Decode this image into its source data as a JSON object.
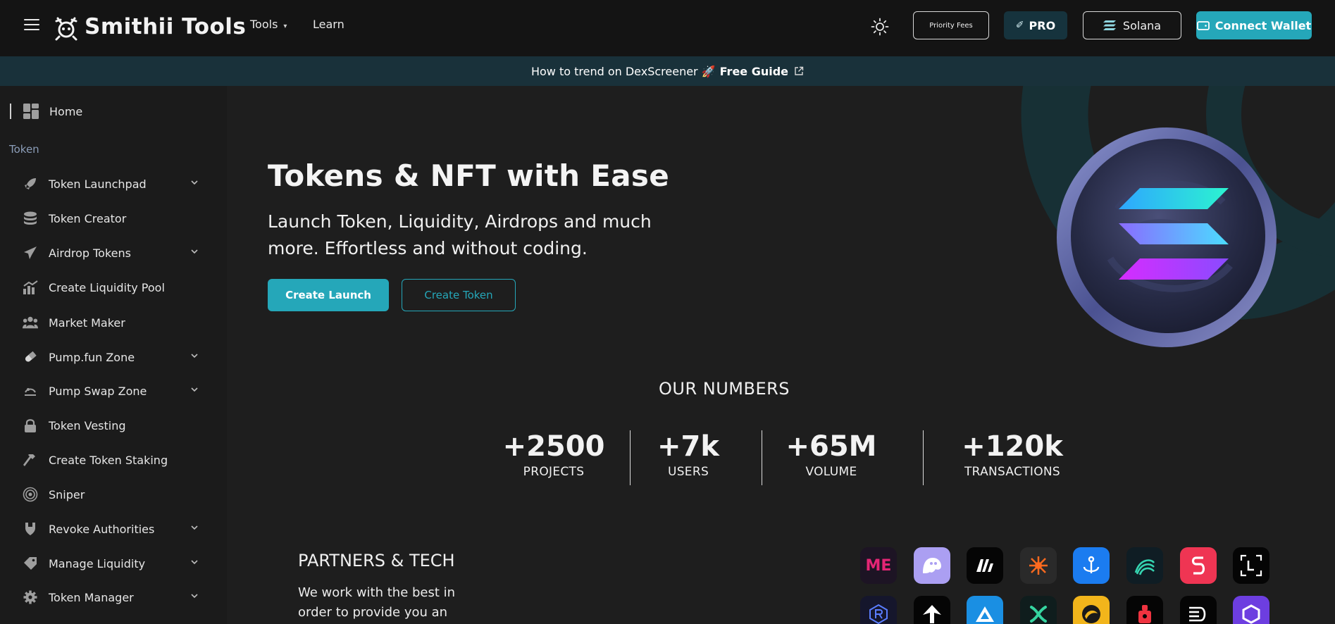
{
  "header": {
    "brand": "Smithii Tools",
    "nav": [
      {
        "label": "Tools"
      },
      {
        "label": "Learn"
      }
    ],
    "priority_fees": "Priority Fees",
    "pro": "PRO",
    "network": "Solana",
    "connect": "Connect Wallet"
  },
  "banner": {
    "text": "How to trend on DexScreener 🚀",
    "link": "Free Guide"
  },
  "sidebar": {
    "home": "Home",
    "section": "Token",
    "items": [
      {
        "label": "Token Launchpad",
        "icon": "rocket-icon"
      },
      {
        "label": "Token Creator",
        "icon": "coins-icon"
      },
      {
        "label": "Airdrop Tokens",
        "icon": "paper-plane-icon"
      },
      {
        "label": "Create Liquidity Pool",
        "icon": "chart-up-icon"
      },
      {
        "label": "Market Maker",
        "icon": "users-icon"
      },
      {
        "label": "Pump.fun Zone",
        "icon": "pill-icon"
      },
      {
        "label": "Pump Swap Zone",
        "icon": "swap-icon"
      },
      {
        "label": "Token Vesting",
        "icon": "lock-icon"
      },
      {
        "label": "Create Token Staking",
        "icon": "hammer-icon"
      },
      {
        "label": "Sniper",
        "icon": "target-icon"
      },
      {
        "label": "Revoke Authorities",
        "icon": "shield-icon"
      },
      {
        "label": "Manage Liquidity",
        "icon": "tag-icon"
      },
      {
        "label": "Token Manager",
        "icon": "gear-icon"
      }
    ]
  },
  "hero": {
    "title": "Tokens & NFT with Ease",
    "subtitle": "Launch Token, Liquidity, Airdrops and much more. Effortless and without coding.",
    "primary_button": "Create Launch",
    "secondary_button": "Create Token"
  },
  "numbers": {
    "title": "OUR NUMBERS",
    "stats": [
      {
        "value": "+2500",
        "label": "PROJECTS"
      },
      {
        "value": "+7k",
        "label": "USERS"
      },
      {
        "value": "+65M",
        "label": "VOLUME"
      },
      {
        "value": "+120k",
        "label": "TRANSACTIONS"
      }
    ]
  },
  "partners": {
    "title": "PARTNERS & TECH",
    "description": "We work with the best in order to provide you an",
    "logos": [
      {
        "icon": "magic-eden-logo-icon",
        "text": "ME",
        "bg": "#1d1424",
        "fg": "#e42575"
      },
      {
        "icon": "phantom-logo-icon",
        "text": "",
        "bg": "#ab9ff2",
        "fg": "#ffffff"
      },
      {
        "icon": "m-logo-icon",
        "text": "",
        "bg": "#050505",
        "fg": "#ffffff"
      },
      {
        "icon": "spark-logo-icon",
        "text": "",
        "bg": "#2a2a2a",
        "fg": "#ff6a1f"
      },
      {
        "icon": "anchor-logo-icon",
        "text": "",
        "bg": "#1b7cf0",
        "fg": "#ffffff"
      },
      {
        "icon": "wave-logo-icon",
        "text": "",
        "bg": "#0f1d24",
        "fg": "#35d4b0"
      },
      {
        "icon": "s-logo-icon",
        "text": "",
        "bg": "#ef3553",
        "fg": "#ffffff"
      },
      {
        "icon": "l-bracket-logo-icon",
        "text": "L",
        "bg": "#050505",
        "fg": "#ffffff"
      },
      {
        "icon": "raydium-logo-icon",
        "text": "R",
        "bg": "#15162c",
        "fg": "#5a7dff"
      },
      {
        "icon": "arrow-logo-icon",
        "text": "",
        "bg": "#050505",
        "fg": "#ffffff"
      },
      {
        "icon": "triangle-logo-icon",
        "text": "",
        "bg": "#1a8fe3",
        "fg": "#ffffff"
      },
      {
        "icon": "x-logo-icon",
        "text": "",
        "bg": "#0f1d1d",
        "fg": "#35d4a0"
      },
      {
        "icon": "bird-logo-icon",
        "text": "",
        "bg": "#f2b51b",
        "fg": "#1a1a1a"
      },
      {
        "icon": "red-logo-icon",
        "text": "",
        "bg": "#050505",
        "fg": "#ef3340"
      },
      {
        "icon": "d-logo-icon",
        "text": "",
        "bg": "#050505",
        "fg": "#ffffff"
      },
      {
        "icon": "hex-logo-icon",
        "text": "",
        "bg": "#6d3ee0",
        "fg": "#ffffff"
      }
    ]
  },
  "colors": {
    "accent": "#25a7b9",
    "banner_bg": "#19313a",
    "header_bg": "#141414",
    "sidebar_bg": "#1b1b1b",
    "page_bg": "#1e1e1e"
  }
}
